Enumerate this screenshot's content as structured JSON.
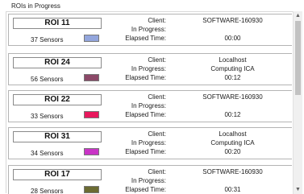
{
  "group": {
    "title": "ROIs in Progress"
  },
  "labels": {
    "client": "Client:",
    "in_progress": "In Progress:",
    "elapsed": "Elapsed Time:"
  },
  "rois": [
    {
      "name": "ROI 11",
      "sensors": "37 Sensors",
      "color": "#93a6dd",
      "client": "SOFTWARE-160930",
      "in_progress": "",
      "elapsed": "00:00"
    },
    {
      "name": "ROI 24",
      "sensors": "56 Sensors",
      "color": "#8c4968",
      "client": "Localhost",
      "in_progress": "Computing ICA",
      "elapsed": "00:12"
    },
    {
      "name": "ROI 22",
      "sensors": "33 Sensors",
      "color": "#e8185d",
      "client": "SOFTWARE-160930",
      "in_progress": "",
      "elapsed": "00:12"
    },
    {
      "name": "ROI 31",
      "sensors": "34 Sensors",
      "color": "#c934c6",
      "client": "Localhost",
      "in_progress": "Computing ICA",
      "elapsed": "00:20"
    },
    {
      "name": "ROI 17",
      "sensors": "28 Sensors",
      "color": "#6b6b32",
      "client": "SOFTWARE-160930",
      "in_progress": "",
      "elapsed": "00:31"
    }
  ],
  "scrollbar": {
    "up_icon": "scroll-up-arrow-icon",
    "down_icon": "scroll-down-arrow-icon"
  }
}
